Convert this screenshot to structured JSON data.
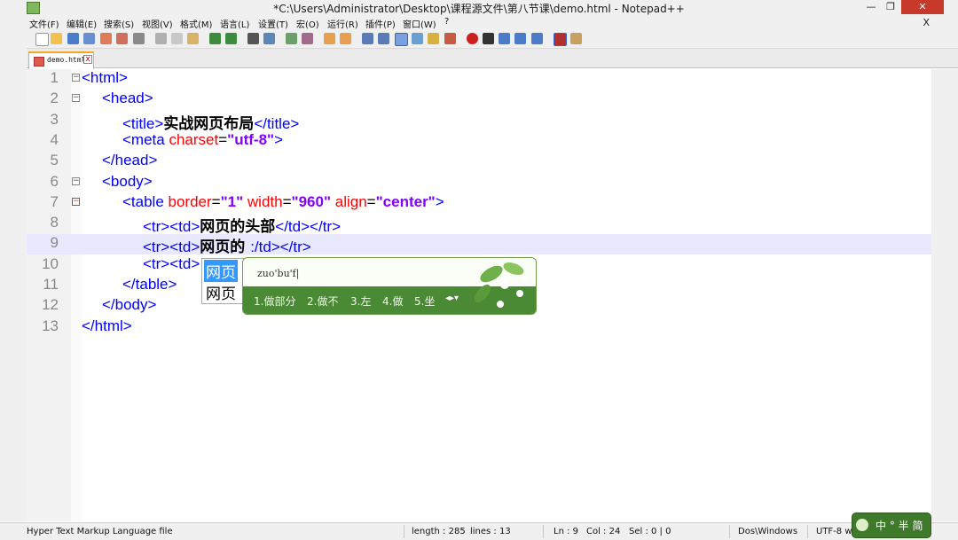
{
  "window": {
    "title": "*C:\\Users\\Administrator\\Desktop\\课程源文件\\第八节课\\demo.html - Notepad++"
  },
  "menu": [
    "文件(F)",
    "编辑(E)",
    "搜索(S)",
    "视图(V)",
    "格式(M)",
    "语言(L)",
    "设置(T)",
    "宏(O)",
    "运行(R)",
    "插件(P)",
    "窗口(W)",
    "?"
  ],
  "menu_close": "X",
  "window_buttons": [
    "—",
    "❐",
    "✕"
  ],
  "tab": {
    "label": "demo.html",
    "close": "x"
  },
  "editor": {
    "current_line": 9,
    "line_numbers": [
      "1",
      "2",
      "3",
      "4",
      "5",
      "6",
      "7",
      "8",
      "9",
      "10",
      "11",
      "12",
      "13"
    ],
    "lines": [
      {
        "parts": [
          [
            "tag",
            "<html>"
          ]
        ]
      },
      {
        "parts": [
          [
            "tag",
            "<head>"
          ]
        ]
      },
      {
        "parts": [
          [
            "tag",
            "<title>"
          ],
          [
            "txt",
            "实战网页布局"
          ],
          [
            "tag",
            "</title>"
          ]
        ]
      },
      {
        "parts": [
          [
            "tag",
            "<meta "
          ],
          [
            "attr",
            "charset"
          ],
          [
            "eq",
            "="
          ],
          [
            "val",
            "\"utf-8\""
          ],
          [
            "tag",
            ">"
          ]
        ]
      },
      {
        "parts": [
          [
            "tag",
            "</head>"
          ]
        ]
      },
      {
        "parts": [
          [
            "tag",
            "<body>"
          ]
        ]
      },
      {
        "parts": [
          [
            "tag",
            "<table "
          ],
          [
            "attr",
            "border"
          ],
          [
            "eq",
            "="
          ],
          [
            "val",
            "\"1\""
          ],
          [
            "attr",
            " width"
          ],
          [
            "eq",
            "="
          ],
          [
            "val",
            "\"960\""
          ],
          [
            "attr",
            " align"
          ],
          [
            "eq",
            "="
          ],
          [
            "val",
            "\"center\""
          ],
          [
            "tag",
            ">"
          ]
        ]
      },
      {
        "parts": [
          [
            "tag",
            "<tr><td>"
          ],
          [
            "txt",
            "网页的头部"
          ],
          [
            "tag",
            "</td></tr>"
          ]
        ]
      },
      {
        "parts": [
          [
            "tag",
            "<tr><td>"
          ],
          [
            "txt",
            "网页的 "
          ],
          [
            "tag",
            ":/td></tr>"
          ]
        ]
      },
      {
        "parts": [
          [
            "tag",
            "<tr><td>"
          ]
        ]
      },
      {
        "parts": [
          [
            "tag",
            "</table>"
          ]
        ]
      },
      {
        "parts": [
          [
            "tag",
            "</body>"
          ]
        ]
      },
      {
        "parts": [
          [
            "tag",
            "</html>"
          ]
        ]
      }
    ]
  },
  "autocomplete": {
    "items": [
      "网页",
      "网页"
    ]
  },
  "ime": {
    "composition": "zuo'bu'f|",
    "candidates": [
      "1.做部分",
      "2.做不",
      "3.左",
      "4.做",
      "5.坐"
    ],
    "arrows": "◂▸▾"
  },
  "status": {
    "file_type": "Hyper Text Markup Language file",
    "length": "length : 285",
    "lines": "lines : 13",
    "ln": "Ln : 9",
    "col": "Col : 24",
    "sel": "Sel : 0 | 0",
    "eol": "Dos\\Windows",
    "encoding": "UTF-8 w/o"
  },
  "ime_status": {
    "label": "中 ° 半 简"
  },
  "colors": {
    "tag": "#0000ff",
    "attr": "#ff0000",
    "value": "#8000ff",
    "current_line": "#e8e8ff",
    "ime_green": "#4a8a34"
  }
}
